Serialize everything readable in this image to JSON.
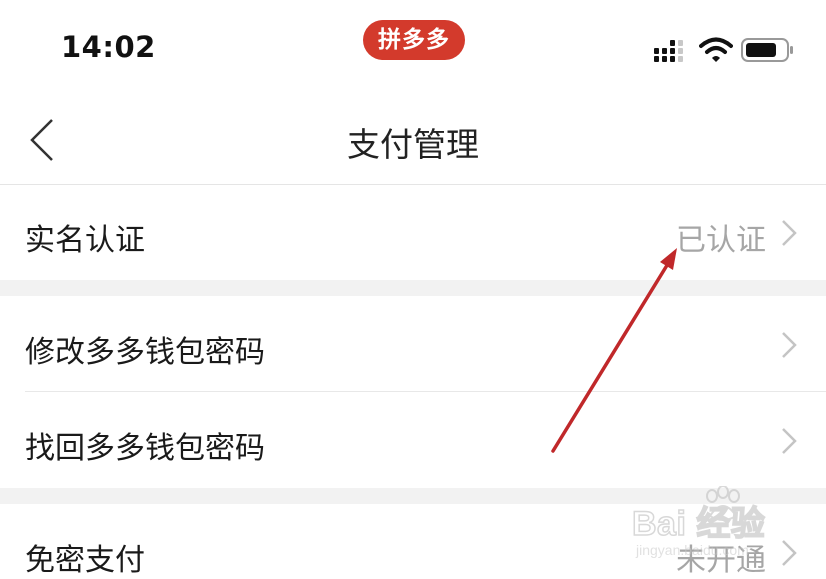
{
  "status_bar": {
    "time": "14:02",
    "app_badge": "拼多多",
    "icons": [
      "signal-icon",
      "wifi-icon",
      "battery-icon"
    ]
  },
  "nav": {
    "title": "支付管理",
    "back_icon": "chevron-left-icon"
  },
  "sections": [
    {
      "items": [
        {
          "label": "实名认证",
          "value": "已认证"
        }
      ]
    },
    {
      "items": [
        {
          "label": "修改多多钱包密码",
          "value": ""
        },
        {
          "label": "找回多多钱包密码",
          "value": ""
        }
      ]
    },
    {
      "items": [
        {
          "label": "免密支付",
          "value": "未开通"
        }
      ]
    }
  ],
  "annotation": {
    "type": "arrow",
    "color": "#c0282a"
  },
  "watermark": {
    "main": "Bai 经验",
    "sub": "jingyan.baidu.com"
  },
  "colors": {
    "badge": "#d33a2c",
    "value_gray": "#a6a6a6",
    "section_gap": "#f2f2f2"
  }
}
